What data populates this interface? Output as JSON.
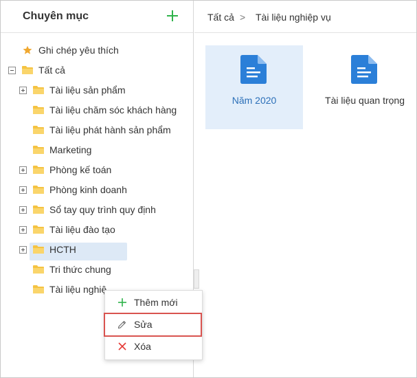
{
  "sidebar": {
    "title": "Chuyên mục",
    "add_icon": "plus-icon",
    "items": [
      {
        "label": "Ghi chép yêu thích",
        "icon": "star-icon",
        "expander": "none"
      },
      {
        "label": "Tất cả",
        "icon": "folder-icon",
        "expander": "minus"
      },
      {
        "label": "Tài liệu sản phẩm",
        "icon": "folder-icon",
        "expander": "plus"
      },
      {
        "label": "Tài liệu chăm sóc khách hàng",
        "icon": "folder-icon",
        "expander": "none"
      },
      {
        "label": "Tài liệu phát hành sản phẩm",
        "icon": "folder-icon",
        "expander": "none"
      },
      {
        "label": "Marketing",
        "icon": "folder-icon",
        "expander": "none"
      },
      {
        "label": "Phòng kế toán",
        "icon": "folder-icon",
        "expander": "plus"
      },
      {
        "label": "Phòng kinh doanh",
        "icon": "folder-icon",
        "expander": "plus"
      },
      {
        "label": "Sổ tay quy trình quy định",
        "icon": "folder-icon",
        "expander": "plus"
      },
      {
        "label": "Tài liệu đào tạo",
        "icon": "folder-icon",
        "expander": "plus"
      },
      {
        "label": "HCTH",
        "icon": "folder-icon",
        "expander": "plus"
      },
      {
        "label": "Tri thức chung",
        "icon": "folder-icon",
        "expander": "none"
      },
      {
        "label": "Tài liệu nghiệ",
        "icon": "folder-icon",
        "expander": "none",
        "selected": true
      }
    ]
  },
  "context_menu": {
    "items": [
      {
        "label": "Thêm mới",
        "icon": "plus-icon"
      },
      {
        "label": "Sửa",
        "icon": "pencil-icon",
        "highlighted": true
      },
      {
        "label": "Xóa",
        "icon": "close-icon"
      }
    ]
  },
  "breadcrumb": {
    "root": "Tất cả",
    "separator": ">",
    "current": "Tài liệu nghiệp vụ"
  },
  "tiles": [
    {
      "name": "Năm 2020",
      "icon": "document-icon",
      "selected": true
    },
    {
      "name": "Tài liệu quan trọng",
      "icon": "document-icon",
      "selected": false
    }
  ],
  "colors": {
    "accent_blue": "#2b7fd8",
    "add_green": "#2eb34a",
    "folder_yellow": "#f5c342",
    "star_orange": "#f0a830",
    "delete_red": "#e53935",
    "highlight_red": "#d9534f",
    "selected_bg": "#dde9f6"
  }
}
